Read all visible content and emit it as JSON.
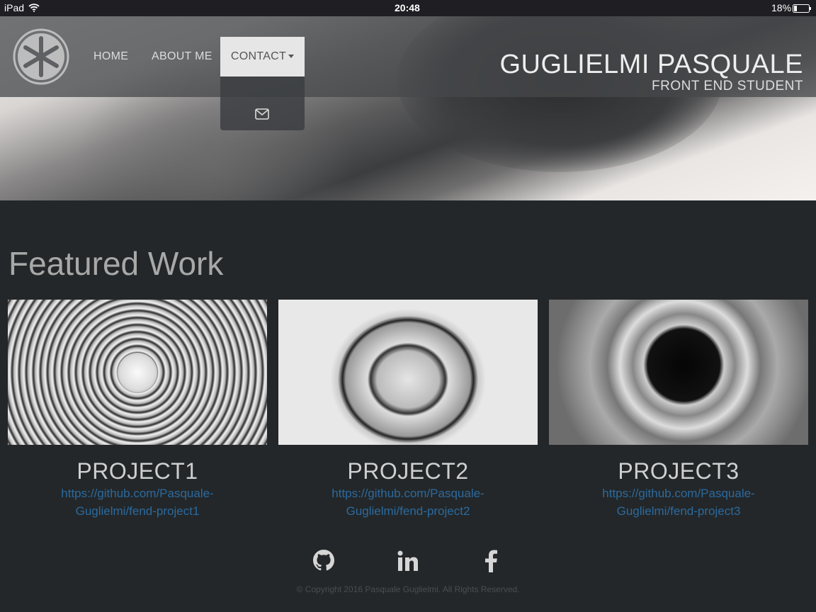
{
  "status_bar": {
    "device": "iPad",
    "time": "20:48",
    "battery": "18%"
  },
  "nav": {
    "items": [
      {
        "label": "HOME"
      },
      {
        "label": "ABOUT ME"
      },
      {
        "label": "CONTACT"
      }
    ],
    "dropdown": [
      {
        "icon": "envelope-icon"
      }
    ]
  },
  "header": {
    "name": "GUGLIELMI PASQUALE",
    "subtitle": "FRONT END STUDENT"
  },
  "main": {
    "heading": "Featured Work",
    "projects": [
      {
        "title": "PROJECT1",
        "link": "https://github.com/Pasquale-Guglielmi/fend-project1"
      },
      {
        "title": "PROJECT2",
        "link": "https://github.com/Pasquale-Guglielmi/fend-project2"
      },
      {
        "title": "PROJECT3",
        "link": "https://github.com/Pasquale-Guglielmi/fend-project3"
      }
    ]
  },
  "footer": {
    "social": [
      "github-icon",
      "linkedin-icon",
      "facebook-icon"
    ],
    "copyright": "© Copyright 2016 Pasquale Guglielmi. All Rights Reserved."
  },
  "colors": {
    "background": "#232729",
    "link": "#2c6a9e"
  }
}
